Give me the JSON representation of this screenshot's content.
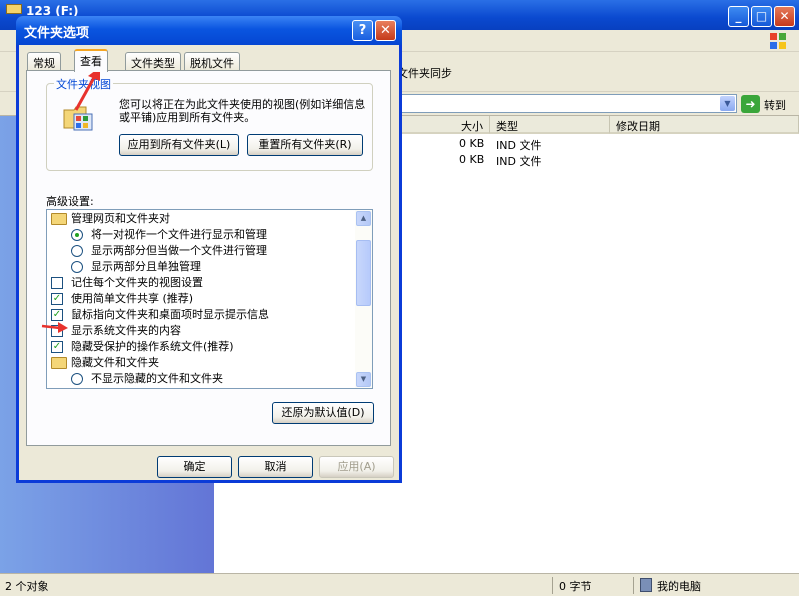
{
  "explorer": {
    "title": "123 (F:)",
    "minimize": "_",
    "maximize": "□",
    "close": "✕",
    "toolbar_sync_label": "文件夹同步",
    "go_label": "转到",
    "columns": [
      "大小",
      "类型",
      "修改日期"
    ],
    "files": [
      {
        "size": "0 KB",
        "type": "IND 文件"
      },
      {
        "size": "0 KB",
        "type": "IND 文件"
      }
    ],
    "status": {
      "objects": "2 个对象",
      "bytes": "0 字节",
      "location": "我的电脑"
    }
  },
  "dialog": {
    "title": "文件夹选项",
    "help": "?",
    "close": "✕",
    "tabs": [
      "常规",
      "查看",
      "文件类型",
      "脱机文件"
    ],
    "active_tab": "查看",
    "folder_views": {
      "label": "文件夹视图",
      "description": "您可以将正在为此文件夹使用的视图(例如详细信息或平铺)应用到所有文件夹。",
      "apply_all": "应用到所有文件夹(L)",
      "reset_all": "重置所有文件夹(R)"
    },
    "advanced_label": "高级设置:",
    "settings": [
      {
        "kind": "folder",
        "level": 0,
        "text": "管理网页和文件夹对"
      },
      {
        "kind": "radio",
        "level": 1,
        "checked": true,
        "text": "将一对视作一个文件进行显示和管理"
      },
      {
        "kind": "radio",
        "level": 1,
        "checked": false,
        "text": "显示两部分但当做一个文件进行管理"
      },
      {
        "kind": "radio",
        "level": 1,
        "checked": false,
        "text": "显示两部分且单独管理"
      },
      {
        "kind": "checkbox",
        "level": 0,
        "checked": false,
        "text": "记住每个文件夹的视图设置"
      },
      {
        "kind": "checkbox",
        "level": 0,
        "checked": true,
        "text": "使用简单文件共享 (推荐)"
      },
      {
        "kind": "checkbox",
        "level": 0,
        "checked": true,
        "text": "鼠标指向文件夹和桌面项时显示提示信息"
      },
      {
        "kind": "checkbox",
        "level": 0,
        "checked": false,
        "text": "显示系统文件夹的内容"
      },
      {
        "kind": "checkbox",
        "level": 0,
        "checked": true,
        "text": "隐藏受保护的操作系统文件(推荐)"
      },
      {
        "kind": "folder",
        "level": 0,
        "text": "隐藏文件和文件夹"
      },
      {
        "kind": "radio",
        "level": 1,
        "checked": false,
        "text": "不显示隐藏的文件和文件夹"
      }
    ],
    "restore_defaults": "还原为默认值(D)",
    "ok": "确定",
    "cancel": "取消",
    "apply": "应用(A)"
  },
  "colors": {
    "annotation_arrow": "#e8322d",
    "xp_blue": "#0a55e0",
    "check_green": "#21a121"
  }
}
